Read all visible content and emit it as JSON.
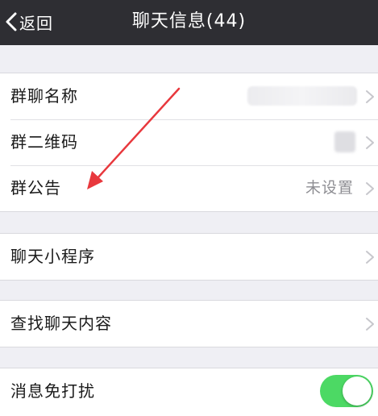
{
  "nav": {
    "back_label": "返回",
    "title": "聊天信息(44)"
  },
  "group1": {
    "items": [
      {
        "label": "群聊名称",
        "value": ""
      },
      {
        "label": "群二维码",
        "value": ""
      },
      {
        "label": "群公告",
        "value": "未设置"
      }
    ]
  },
  "group2": {
    "items": [
      {
        "label": "聊天小程序"
      }
    ]
  },
  "group3": {
    "items": [
      {
        "label": "查找聊天内容"
      }
    ]
  },
  "group4": {
    "items": [
      {
        "label": "消息免打扰",
        "toggle_on": true
      }
    ]
  },
  "colors": {
    "nav_bg": "#2e2e33",
    "toggle_on": "#4cd964",
    "annotation_arrow": "#e8383d"
  },
  "icons": [
    "chevron-left-icon",
    "chevron-right-icon",
    "toggle-switch",
    "annotation-arrow"
  ]
}
